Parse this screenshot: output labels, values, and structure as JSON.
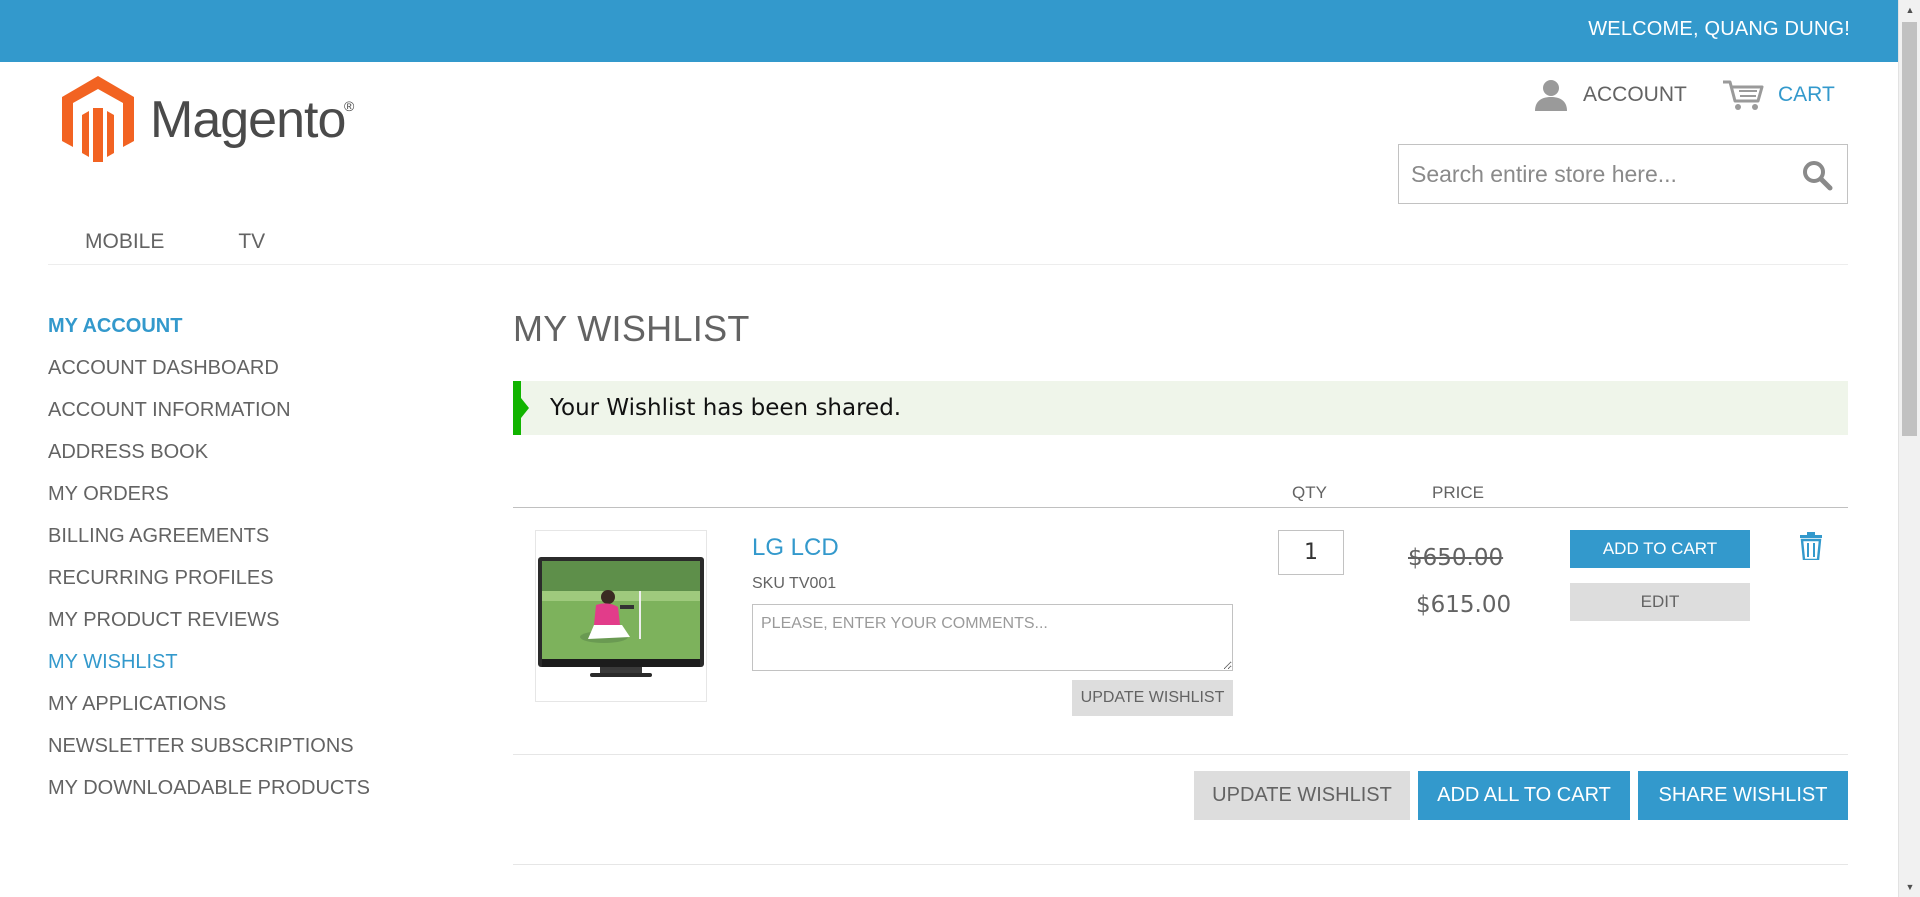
{
  "colors": {
    "accent": "#3399cc",
    "success": "#11b400",
    "success_bg": "#eff5ea",
    "text": "#636363",
    "button_grey": "#dddddd"
  },
  "header": {
    "welcome": "WELCOME, QUANG DUNG!",
    "logo_text": "Magento",
    "logo_reg": "®",
    "account_label": "ACCOUNT",
    "account_icon": "user-icon",
    "cart_label": "CART",
    "cart_icon": "cart-icon"
  },
  "search": {
    "placeholder": "Search entire store here...",
    "value": "",
    "icon": "search-icon"
  },
  "nav": {
    "items": [
      {
        "label": "MOBILE"
      },
      {
        "label": "TV"
      }
    ]
  },
  "sidebar": {
    "title": "MY ACCOUNT",
    "items": [
      {
        "label": "ACCOUNT DASHBOARD",
        "active": false
      },
      {
        "label": "ACCOUNT INFORMATION",
        "active": false
      },
      {
        "label": "ADDRESS BOOK",
        "active": false
      },
      {
        "label": "MY ORDERS",
        "active": false
      },
      {
        "label": "BILLING AGREEMENTS",
        "active": false
      },
      {
        "label": "RECURRING PROFILES",
        "active": false
      },
      {
        "label": "MY PRODUCT REVIEWS",
        "active": false
      },
      {
        "label": "MY WISHLIST",
        "active": true
      },
      {
        "label": "MY APPLICATIONS",
        "active": false
      },
      {
        "label": "NEWSLETTER SUBSCRIPTIONS",
        "active": false
      },
      {
        "label": "MY DOWNLOADABLE PRODUCTS",
        "active": false
      }
    ]
  },
  "main": {
    "title": "MY WISHLIST",
    "success_message": "Your Wishlist has been shared.",
    "columns": {
      "qty": "QTY",
      "price": "PRICE"
    },
    "items": [
      {
        "name": "LG LCD",
        "sku": "SKU TV001",
        "comment_placeholder": "PLEASE, ENTER YOUR COMMENTS...",
        "comment_value": "",
        "qty": "1",
        "old_price": "$650.00",
        "price": "$615.00",
        "update_label": "UPDATE WISHLIST",
        "add_to_cart_label": "ADD TO CART",
        "edit_label": "EDIT",
        "remove_icon": "trash-icon"
      }
    ],
    "actions": {
      "update_wishlist": "UPDATE WISHLIST",
      "add_all_to_cart": "ADD ALL TO CART",
      "share_wishlist": "SHARE WISHLIST"
    }
  }
}
